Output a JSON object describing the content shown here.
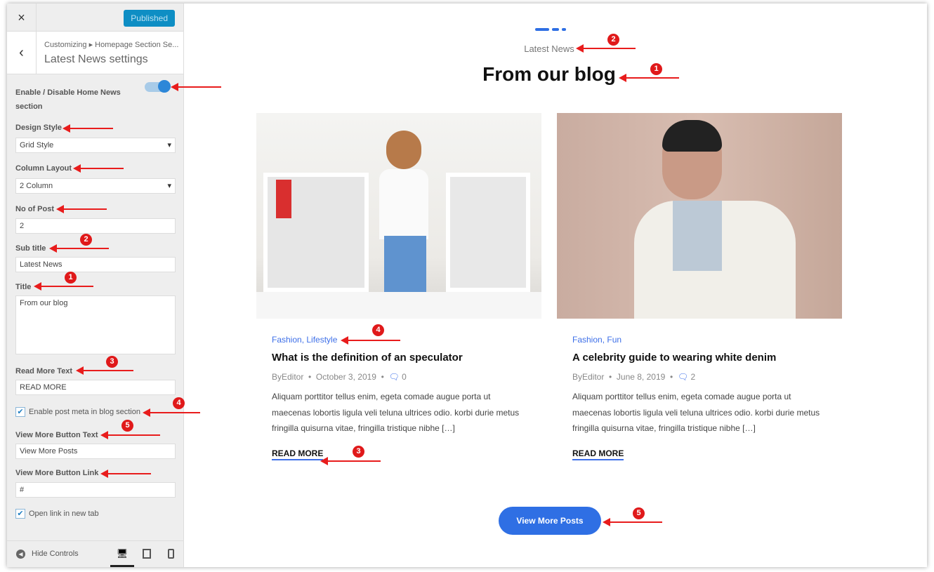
{
  "sidebar": {
    "close_icon": "×",
    "publish_label": "Published",
    "back_icon": "‹",
    "breadcrumb": "Customizing ▸ Homepage Section Se...",
    "panel_title": "Latest News settings",
    "toggle": {
      "label": "Enable / Disable Home News section",
      "on": true
    },
    "design_style": {
      "label": "Design Style",
      "value": "Grid Style"
    },
    "column_layout": {
      "label": "Column Layout",
      "value": "2 Column"
    },
    "no_of_post": {
      "label": "No of Post",
      "value": "2"
    },
    "sub_title": {
      "label": "Sub title",
      "value": "Latest News"
    },
    "title": {
      "label": "Title",
      "value": "From our blog"
    },
    "read_more": {
      "label": "Read More Text",
      "value": "READ MORE"
    },
    "post_meta": {
      "label": "Enable post meta in blog section",
      "checked": true
    },
    "view_more_text": {
      "label": "View More Button Text",
      "value": "View More Posts"
    },
    "view_more_link": {
      "label": "View More Button Link",
      "value": "#"
    },
    "new_tab": {
      "label": "Open link in new tab",
      "checked": true
    },
    "hide_controls": "Hide Controls"
  },
  "preview": {
    "subtitle": "Latest News",
    "title": "From our blog",
    "posts": [
      {
        "categories": "Fashion,  Lifestyle",
        "title": "What is the definition of an speculator",
        "author": "ByEditor",
        "date": "October 3, 2019",
        "comments": "0",
        "excerpt": "Aliquam porttitor tellus enim, egeta comade augue porta ut maecenas lobortis ligula veli teluna ultrices odio. korbi durie metus fringilla quisurna vitae, fringilla tristique nibhe […]",
        "read_more": "READ MORE"
      },
      {
        "categories": "Fashion,  Fun",
        "title": "A celebrity guide to wearing white denim",
        "author": "ByEditor",
        "date": "June 8, 2019",
        "comments": "2",
        "excerpt": "Aliquam porttitor tellus enim, egeta comade augue porta ut maecenas lobortis ligula veli teluna ultrices odio. korbi durie metus fringilla quisurna vitae, fringilla tristique nibhe […]",
        "read_more": "READ MORE"
      }
    ],
    "view_more": "View More Posts"
  },
  "annotations": [
    "1",
    "2",
    "3",
    "4",
    "5"
  ],
  "colors": {
    "accent": "#2f6fe4",
    "publish": "#0e8ec4",
    "annotation": "#e0191a"
  }
}
